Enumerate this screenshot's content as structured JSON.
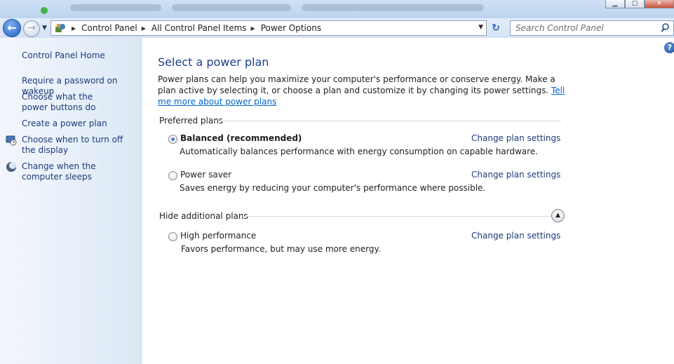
{
  "window": {
    "controls": {
      "minimize": "▁",
      "maximize": "▢",
      "close": "✕"
    }
  },
  "nav": {
    "back_icon": "back-arrow-icon",
    "forward_icon": "forward-arrow-icon",
    "breadcrumbs": [
      "Control Panel",
      "All Control Panel Items",
      "Power Options"
    ],
    "search_placeholder": "Search Control Panel"
  },
  "sidebar": {
    "home": "Control Panel Home",
    "links": [
      {
        "label": "Require a password on wakeup",
        "icon": null
      },
      {
        "label": "Choose what the power buttons do",
        "icon": null
      },
      {
        "label": "Create a power plan",
        "icon": null
      },
      {
        "label": "Choose when to turn off the display",
        "icon": "display-clock-icon"
      },
      {
        "label": "Change when the computer sleeps",
        "icon": "moon-sleep-icon"
      }
    ]
  },
  "main": {
    "title": "Select a power plan",
    "intro_text": "Power plans can help you maximize your computer's performance or conserve energy. Make a plan active by selecting it, or choose a plan and customize it by changing its power settings. ",
    "intro_link": "Tell me more about power plans",
    "preferred_header": "Preferred plans",
    "hidden_header": "Hide additional plans",
    "plans": [
      {
        "name": "Balanced (recommended)",
        "description": "Automatically balances performance with energy consumption on capable hardware.",
        "selected": true,
        "change_link": "Change plan settings"
      },
      {
        "name": "Power saver",
        "description": "Saves energy by reducing your computer's performance where possible.",
        "selected": false,
        "change_link": "Change plan settings"
      },
      {
        "name": "High performance",
        "description": "Favors performance, but may use more energy.",
        "selected": false,
        "change_link": "Change plan settings"
      }
    ]
  },
  "colors": {
    "link": "#1c3b7a",
    "title": "#1f3e8e",
    "sidebar_bg": "#dce8f6"
  }
}
